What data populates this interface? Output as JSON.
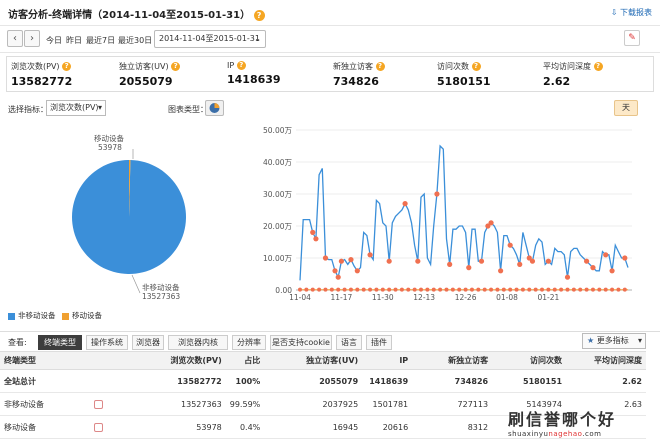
{
  "title": "访客分析-终端详情（2014-11-04至2015-01-31）",
  "help_icon": "?",
  "download_label": "下载报表",
  "toolbar": {
    "today": "今日",
    "yesterday": "昨日",
    "last7": "最近7日",
    "last30": "最近30日",
    "date_range": "2014-11-04至2015-01-31"
  },
  "metrics": [
    {
      "label": "浏览次数(PV)",
      "value": "13582772"
    },
    {
      "label": "独立访客(UV)",
      "value": "2055079"
    },
    {
      "label": "IP",
      "value": "1418639"
    },
    {
      "label": "新独立访客",
      "value": "734826"
    },
    {
      "label": "访问次数",
      "value": "5180151"
    },
    {
      "label": "平均访问深度",
      "value": "2.62"
    }
  ],
  "controls": {
    "select_metric_label": "选择指标：",
    "select_metric_value": "浏览次数(PV)",
    "chart_type_label": "图表类型：",
    "day_button": "天"
  },
  "pie": {
    "mobile_label": "移动设备",
    "mobile_value": "53978",
    "nonmobile_label": "非移动设备",
    "nonmobile_value": "13527363",
    "legend_nonmobile": "非移动设备",
    "legend_mobile": "移动设备",
    "colors": {
      "nonmobile": "#3b8fd9",
      "mobile": "#f0a030"
    }
  },
  "chart_data": {
    "type": "line",
    "y_ticks": [
      "0.00",
      "10.00万",
      "20.00万",
      "30.00万",
      "40.00万",
      "50.00万"
    ],
    "x_ticks": [
      "11-04",
      "11-17",
      "11-30",
      "12-13",
      "12-26",
      "01-08",
      "01-21"
    ],
    "ylim": [
      0,
      500000
    ],
    "series": [
      {
        "name": "非移动设备",
        "color": "#3b8fd9",
        "values": [
          30000,
          220000,
          220000,
          220000,
          180000,
          160000,
          360000,
          380000,
          100000,
          95000,
          95000,
          60000,
          40000,
          90000,
          95000,
          80000,
          95000,
          75000,
          60000,
          70000,
          180000,
          170000,
          110000,
          95000,
          280000,
          270000,
          210000,
          200000,
          90000,
          210000,
          230000,
          240000,
          250000,
          270000,
          250000,
          210000,
          140000,
          90000,
          290000,
          300000,
          100000,
          80000,
          200000,
          300000,
          450000,
          440000,
          160000,
          80000,
          190000,
          190000,
          200000,
          200000,
          180000,
          70000,
          190000,
          190000,
          90000,
          90000,
          180000,
          200000,
          210000,
          200000,
          180000,
          60000,
          170000,
          170000,
          140000,
          130000,
          110000,
          80000,
          180000,
          140000,
          100000,
          90000,
          140000,
          160000,
          150000,
          80000,
          90000,
          80000,
          130000,
          120000,
          120000,
          110000,
          40000,
          120000,
          130000,
          130000,
          110000,
          100000,
          90000,
          80000,
          70000,
          60000,
          60000,
          120000,
          110000,
          110000,
          60000,
          140000,
          120000,
          100000,
          100000,
          70000
        ],
        "marker_indices": [
          4,
          5,
          8,
          11,
          12,
          13,
          16,
          18,
          22,
          28,
          33,
          37,
          43,
          47,
          53,
          57,
          59,
          60,
          63,
          66,
          69,
          72,
          73,
          78,
          84,
          90,
          92,
          96,
          98,
          102
        ]
      },
      {
        "name": "移动设备",
        "color": "#f0a030",
        "values": [
          1000,
          1000,
          1000,
          1000,
          1000,
          1000,
          1000,
          1000,
          1000,
          1000,
          1000,
          1000,
          1000,
          1000,
          1000,
          1000,
          1000,
          1000,
          1000,
          1000,
          1000,
          1000,
          1000,
          1000,
          1000,
          1000,
          1000,
          1000,
          1000,
          1000,
          1000,
          1000,
          1000,
          1000,
          1000,
          1000,
          1000,
          1000,
          1000,
          1000,
          1000,
          1000,
          1000,
          1000,
          1000,
          1000,
          1000,
          1000,
          1000,
          1000,
          1000,
          1000,
          1000,
          1000,
          1000,
          1000,
          1000,
          1000,
          1000,
          1000,
          1000,
          1000,
          1000,
          1000,
          1000,
          1000,
          1000,
          1000,
          1000,
          1000,
          1000,
          1000,
          1000,
          1000,
          1000,
          1000,
          1000,
          1000,
          1000,
          1000,
          1000,
          1000,
          1000,
          1000,
          1000,
          1000,
          1000,
          1000,
          1000,
          1000,
          1000,
          1000,
          1000,
          1000,
          1000,
          1000,
          1000,
          1000,
          1000,
          1000,
          1000,
          1000,
          1000,
          1000
        ]
      }
    ]
  },
  "tabs": {
    "view_label": "查看:",
    "items": [
      "终端类型",
      "操作系统",
      "浏览器",
      "浏览器内核",
      "分辨率",
      "是否支持cookie",
      "语言",
      "插件"
    ],
    "more_metrics": "更多指标"
  },
  "table": {
    "headers": [
      "终端类型",
      "浏览次数(PV)",
      "占比",
      "独立访客(UV)",
      "IP",
      "新独立访客",
      "访问次数",
      "平均访问深度"
    ],
    "rows": [
      {
        "name": "全站总计",
        "pv": "13582772",
        "ratio": "100%",
        "uv": "2055079",
        "ip": "1418639",
        "new": "734826",
        "visits": "5180151",
        "depth": "2.62"
      },
      {
        "name": "非移动设备",
        "pv": "13527363",
        "ratio": "99.59%",
        "uv": "2037925",
        "ip": "1501781",
        "new": "727113",
        "visits": "5143974",
        "depth": "2.63"
      },
      {
        "name": "移动设备",
        "pv": "53978",
        "ratio": "0.4%",
        "uv": "16945",
        "ip": "20616",
        "new": "8312",
        "visits": "",
        "depth": ""
      }
    ]
  },
  "watermark": {
    "main": "刷信誉哪个好",
    "url_a": "shuaxinyu",
    "url_b": "nagehao",
    "url_c": ".com"
  }
}
